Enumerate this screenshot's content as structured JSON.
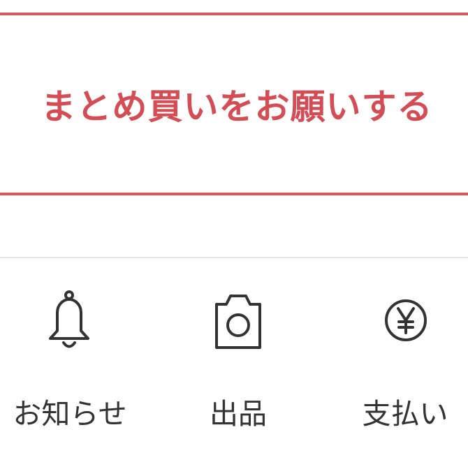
{
  "bulk_purchase": {
    "label": "まとめ買いをお願いする"
  },
  "tab_bar": {
    "items": [
      {
        "label": "お知らせ",
        "icon": "bell-icon"
      },
      {
        "label": "出品",
        "icon": "camera-icon"
      },
      {
        "label": "支払い",
        "icon": "yen-icon"
      }
    ]
  },
  "colors": {
    "accent": "#d44d55",
    "border_accent": "#d75a5f",
    "icon": "#333333",
    "divider": "#e5e5e5"
  }
}
